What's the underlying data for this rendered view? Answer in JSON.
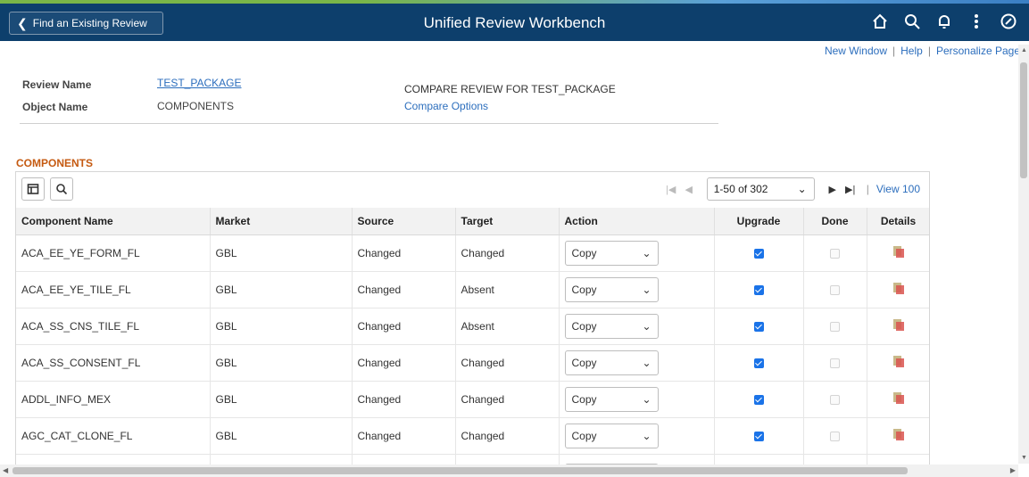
{
  "header": {
    "back_label": "Find an Existing Review",
    "title": "Unified Review Workbench",
    "icons": [
      "home-icon",
      "search-icon",
      "bell-icon",
      "more-icon",
      "compass-icon"
    ]
  },
  "toplinks": {
    "new_window": "New Window",
    "help": "Help",
    "personalize": "Personalize Page"
  },
  "info": {
    "review_name_label": "Review Name",
    "review_name_value": "TEST_PACKAGE",
    "object_name_label": "Object Name",
    "object_name_value": "COMPONENTS",
    "compare_title": "COMPARE REVIEW FOR TEST_PACKAGE",
    "compare_options": "Compare Options"
  },
  "grid": {
    "section_title": "COMPONENTS",
    "pager_range": "1-50 of 302",
    "view_all": "View 100",
    "columns": [
      "Component Name",
      "Market",
      "Source",
      "Target",
      "Action",
      "Upgrade",
      "Done",
      "Details"
    ],
    "rows": [
      {
        "name": "ACA_EE_YE_FORM_FL",
        "market": "GBL",
        "source": "Changed",
        "target": "Changed",
        "action": "Copy",
        "upgrade": true,
        "done": false
      },
      {
        "name": "ACA_EE_YE_TILE_FL",
        "market": "GBL",
        "source": "Changed",
        "target": "Absent",
        "action": "Copy",
        "upgrade": true,
        "done": false
      },
      {
        "name": "ACA_SS_CNS_TILE_FL",
        "market": "GBL",
        "source": "Changed",
        "target": "Absent",
        "action": "Copy",
        "upgrade": true,
        "done": false
      },
      {
        "name": "ACA_SS_CONSENT_FL",
        "market": "GBL",
        "source": "Changed",
        "target": "Changed",
        "action": "Copy",
        "upgrade": true,
        "done": false
      },
      {
        "name": "ADDL_INFO_MEX",
        "market": "GBL",
        "source": "Changed",
        "target": "Changed",
        "action": "Copy",
        "upgrade": true,
        "done": false
      },
      {
        "name": "AGC_CAT_CLONE_FL",
        "market": "GBL",
        "source": "Changed",
        "target": "Changed",
        "action": "Copy",
        "upgrade": true,
        "done": false
      }
    ]
  },
  "colors": {
    "header_bg": "#0d3f6c",
    "link": "#2c6ebd",
    "section_title": "#c55a11",
    "checkbox": "#1a73e8"
  }
}
